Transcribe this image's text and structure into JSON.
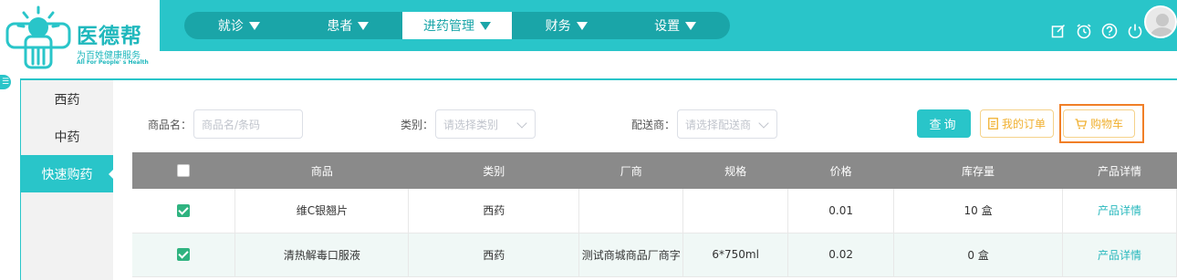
{
  "brand": {
    "name": "医德帮",
    "slogan": "为百姓健康服务",
    "slogan_en": "All For People' s Health",
    "primary_color": "#29c5c9",
    "nav_dark_color": "#1aa5a8",
    "accent_orange": "#f07f27"
  },
  "topnav": [
    {
      "label": "就诊",
      "active": false
    },
    {
      "label": "患者",
      "active": false
    },
    {
      "label": "进药管理",
      "active": true
    },
    {
      "label": "财务",
      "active": false
    },
    {
      "label": "设置",
      "active": false
    }
  ],
  "header_icons": [
    "edit-icon",
    "alarm-clock-icon",
    "help-icon",
    "power-icon"
  ],
  "sidenav": [
    {
      "label": "西药",
      "active": false
    },
    {
      "label": "中药",
      "active": false
    },
    {
      "label": "快速购药",
      "active": true
    }
  ],
  "filters": {
    "product_label": "商品名：",
    "product_placeholder": "商品名/条码",
    "category_label": "类别：",
    "category_placeholder": "请选择类别",
    "supplier_label": "配送商：",
    "supplier_placeholder": "请选择配送商"
  },
  "buttons": {
    "query": "查询",
    "my_orders": "我的订单",
    "cart": "购物车"
  },
  "table": {
    "headers": [
      "",
      "商品",
      "类别",
      "厂商",
      "规格",
      "价格",
      "库存量",
      "产品详情"
    ],
    "rows": [
      {
        "checked": true,
        "product": "维C银翘片",
        "category": "西药",
        "manufacturer": "",
        "spec": "",
        "price": "0.01",
        "stock": "10 盒",
        "detail": "产品详情"
      },
      {
        "checked": true,
        "product": "清热解毒口服液",
        "category": "西药",
        "manufacturer": "测试商城商品厂商字",
        "spec": "6*750ml",
        "price": "0.02",
        "stock": "0 盒",
        "detail": "产品详情"
      }
    ]
  }
}
